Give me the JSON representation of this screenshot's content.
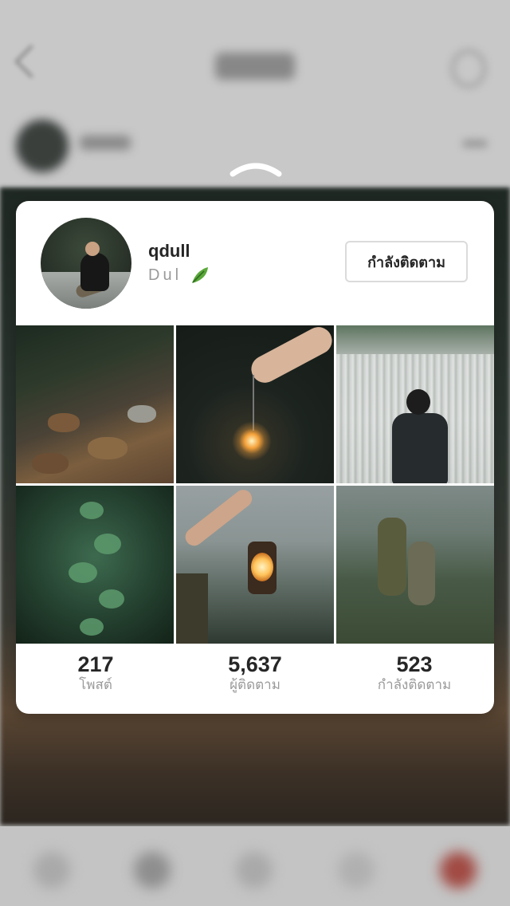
{
  "profile_preview": {
    "username": "qdull",
    "full_name": "Dul",
    "name_emoji_icon": "leaf-icon",
    "follow_button_label": "กำลังติดตาม"
  },
  "posts": [
    {
      "subject": "rocky stream in forest"
    },
    {
      "subject": "hand holding sparkler"
    },
    {
      "subject": "hiker with backpack at waterfall"
    },
    {
      "subject": "green fern leaves"
    },
    {
      "subject": "hand holding lantern over mountains"
    },
    {
      "subject": "hikers on mountain with camera"
    }
  ],
  "stats": [
    {
      "value": "217",
      "label": "โพสต์"
    },
    {
      "value": "5,637",
      "label": "ผู้ติดตาม"
    },
    {
      "value": "523",
      "label": "กำลังติดตาม"
    }
  ],
  "colors": {
    "card_background": "#ffffff",
    "primary_text": "#262626",
    "secondary_text": "#9a9a9a",
    "button_border": "#dbdbdb"
  }
}
